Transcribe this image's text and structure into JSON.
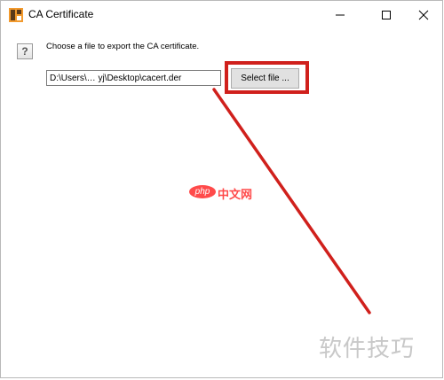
{
  "window": {
    "title": "CA Certificate",
    "controls": {
      "minimize": "minimize",
      "maximize": "maximize",
      "close": "close"
    }
  },
  "dialog": {
    "help_icon_glyph": "?",
    "prompt": "Choose a file to export the CA certificate.",
    "file_path": "D:\\Users\\… yj\\Desktop\\cacert.der",
    "select_button_label": "Select file ..."
  },
  "annotation": {
    "color": "#d0201c"
  },
  "watermarks": {
    "center_logo": "php",
    "center_text": "中文网",
    "corner_text": "软件技巧"
  },
  "colors": {
    "accent": "#d0201c",
    "php_red": "#ff4a4a"
  }
}
